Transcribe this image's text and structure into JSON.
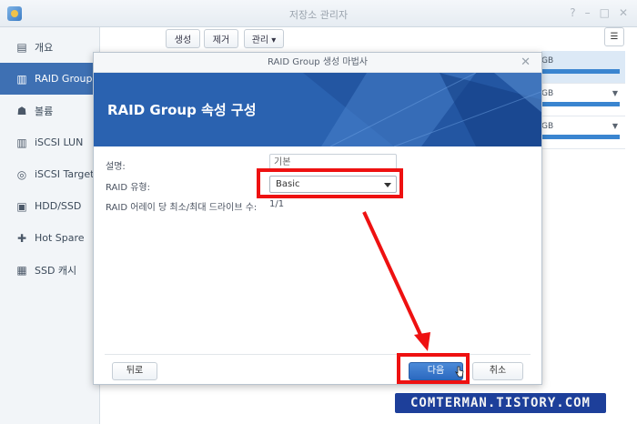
{
  "window": {
    "title": "저장소 관리자",
    "controls": [
      "?",
      "–",
      "□",
      "✕"
    ]
  },
  "sidebar": {
    "items": [
      {
        "label": "개요",
        "icon": "overview-icon",
        "glyph": "▤"
      },
      {
        "label": "RAID Group",
        "icon": "raid-group-icon",
        "glyph": "▥",
        "active": true
      },
      {
        "label": "볼륨",
        "icon": "volume-icon",
        "glyph": "☗"
      },
      {
        "label": "iSCSI LUN",
        "icon": "iscsi-lun-icon",
        "glyph": "▥"
      },
      {
        "label": "iSCSI Target",
        "icon": "iscsi-target-icon",
        "glyph": "◎"
      },
      {
        "label": "HDD/SSD",
        "icon": "hdd-icon",
        "glyph": "▣"
      },
      {
        "label": "Hot Spare",
        "icon": "hot-spare-icon",
        "glyph": "✚"
      },
      {
        "label": "SSD 캐시",
        "icon": "ssd-cache-icon",
        "glyph": "▦"
      }
    ]
  },
  "toolbar": {
    "create_label": "생성",
    "delete_label": "제거",
    "manage_label": "관리 ▾",
    "list_icon": "list-view-icon"
  },
  "volumes": [
    {
      "suffix": "GB",
      "selected": true
    },
    {
      "suffix": "GB",
      "selected": false
    },
    {
      "suffix": "GB",
      "selected": false
    }
  ],
  "dialog": {
    "title": "RAID Group 생성 마법사",
    "banner_title": "RAID Group 속성 구성",
    "description_label": "설명:",
    "description_value": "기본",
    "raid_type_label": "RAID 유형:",
    "raid_type_value": "Basic",
    "drive_count_label": "RAID 어레이 당 최소/최대 드라이브 수:",
    "drive_count_value": "1/1",
    "back_label": "뒤로",
    "next_label": "다음",
    "cancel_label": "취소"
  },
  "colors": {
    "accent": "#3e70b3",
    "highlight": "#ee1111",
    "banner": "#2a62b0"
  },
  "watermark": "COMTERMAN.TISTORY.COM"
}
